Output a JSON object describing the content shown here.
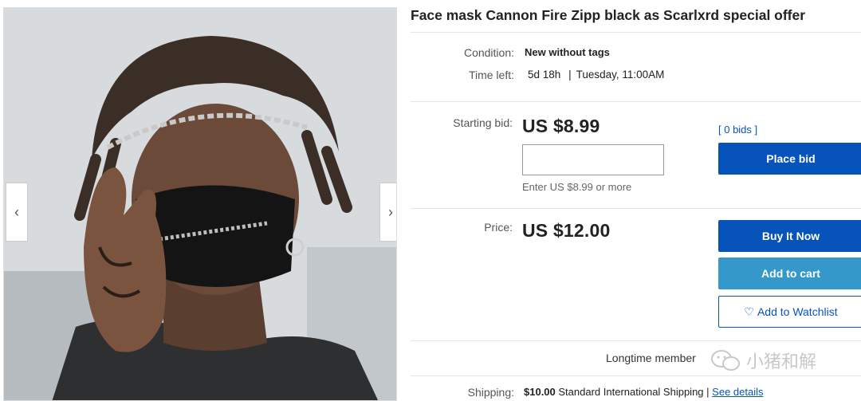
{
  "listing": {
    "title": "Face mask Cannon Fire Zipp black as Scarlxrd special offer"
  },
  "details": {
    "condition_label": "Condition:",
    "condition_value": "New without tags",
    "time_left_label": "Time left:",
    "time_left_value": "5d 18h",
    "time_left_separator": "|",
    "time_left_end": "Tuesday, 11:00AM"
  },
  "bid": {
    "label": "Starting bid:",
    "price": "US $8.99",
    "bids_link": "[ 0 bids ]",
    "input_value": "",
    "hint": "Enter US $8.99 or more",
    "place_bid_label": "Place bid"
  },
  "buy": {
    "label": "Price:",
    "price": "US $12.00",
    "buy_now_label": "Buy It Now",
    "add_to_cart_label": "Add to cart",
    "watchlist_label": "Add to Watchlist"
  },
  "seller": {
    "member_text": "Longtime member"
  },
  "shipping": {
    "label": "Shipping:",
    "amount": "$10.00",
    "method": "Standard International Shipping",
    "separator": "|",
    "details_link": "See details"
  },
  "watermark": {
    "text": "小猪和解"
  },
  "gallery": {
    "prev_icon": "chevron-left-icon",
    "next_icon": "chevron-right-icon"
  },
  "colors": {
    "primary_button": "#0654ba",
    "secondary_button": "#3498ca",
    "link": "#0654ba"
  }
}
